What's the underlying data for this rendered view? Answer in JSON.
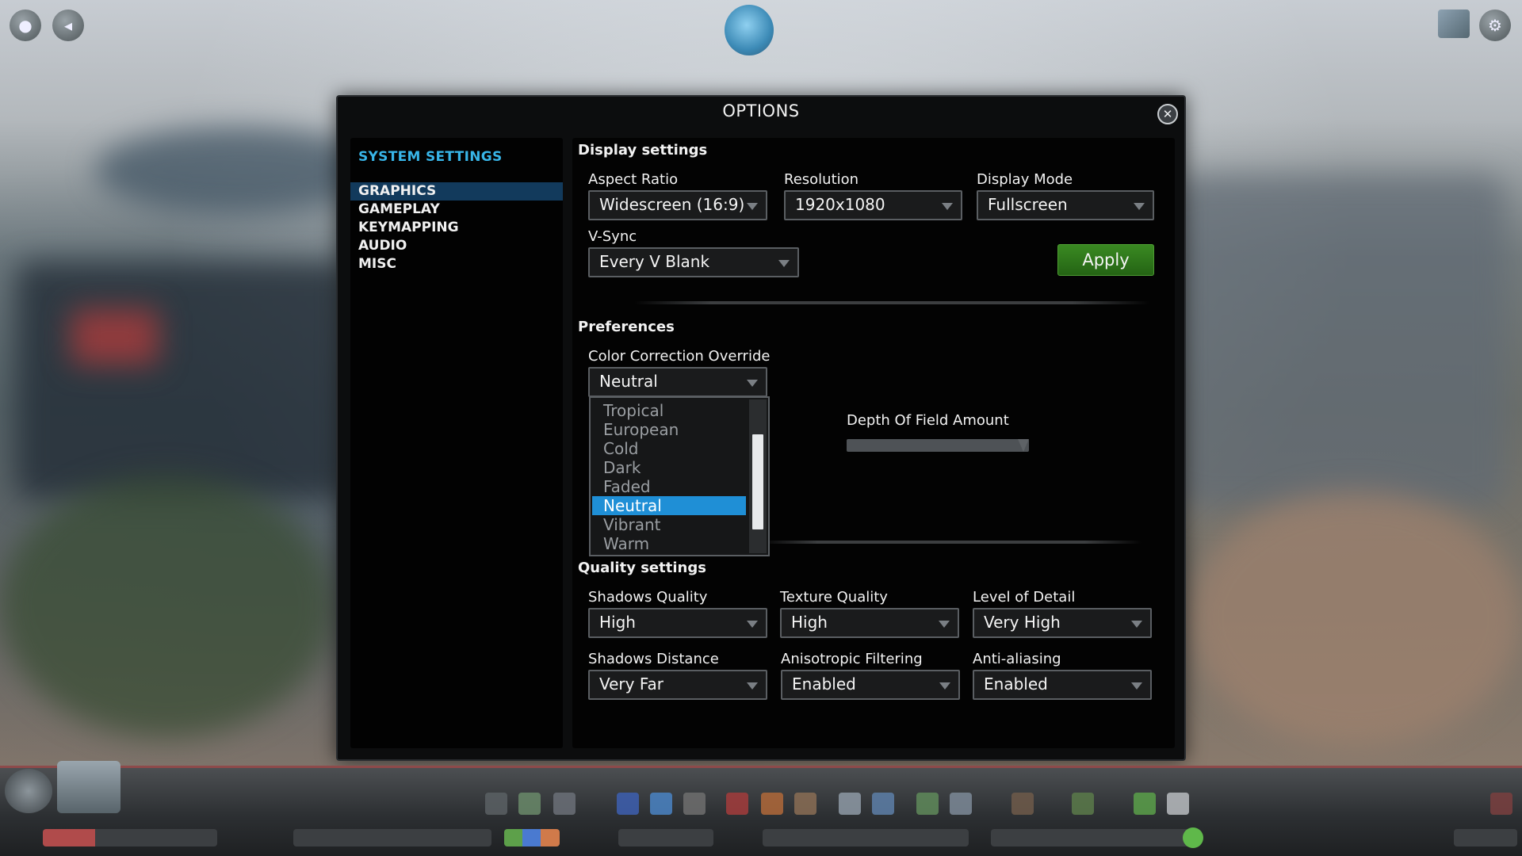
{
  "dialog": {
    "title": "OPTIONS",
    "close_symbol": "✕"
  },
  "sidebar": {
    "header": "SYSTEM SETTINGS",
    "items": [
      {
        "label": "GRAPHICS",
        "active": true
      },
      {
        "label": "GAMEPLAY",
        "active": false
      },
      {
        "label": "KEYMAPPING",
        "active": false
      },
      {
        "label": "AUDIO",
        "active": false
      },
      {
        "label": "MISC",
        "active": false
      }
    ]
  },
  "display_settings": {
    "title": "Display settings",
    "aspect_ratio": {
      "label": "Aspect Ratio",
      "value": "Widescreen (16:9)"
    },
    "resolution": {
      "label": "Resolution",
      "value": "1920x1080"
    },
    "display_mode": {
      "label": "Display Mode",
      "value": "Fullscreen"
    },
    "vsync": {
      "label": "V-Sync",
      "value": "Every V Blank"
    },
    "apply_label": "Apply"
  },
  "preferences": {
    "title": "Preferences",
    "color_correction": {
      "label": "Color Correction Override",
      "value": "Neutral",
      "options": [
        "Tropical",
        "European",
        "Cold",
        "Dark",
        "Faded",
        "Neutral",
        "Vibrant",
        "Warm"
      ],
      "selected_index": 5
    },
    "depth_of_field": {
      "label": "Depth Of Field Amount"
    }
  },
  "quality_settings": {
    "title": "Quality settings",
    "shadows_quality": {
      "label": "Shadows Quality",
      "value": "High"
    },
    "texture_quality": {
      "label": "Texture Quality",
      "value": "High"
    },
    "level_of_detail": {
      "label": "Level of Detail",
      "value": "Very High"
    },
    "shadows_distance": {
      "label": "Shadows Distance",
      "value": "Very Far"
    },
    "anisotropic_filtering": {
      "label": "Anisotropic Filtering",
      "value": "Enabled"
    },
    "anti_aliasing": {
      "label": "Anti-aliasing",
      "value": "Enabled"
    }
  },
  "colors": {
    "accent_blue": "#38b5e8",
    "selection_blue": "#1f8fd6",
    "apply_green": "#2f7a1c"
  }
}
